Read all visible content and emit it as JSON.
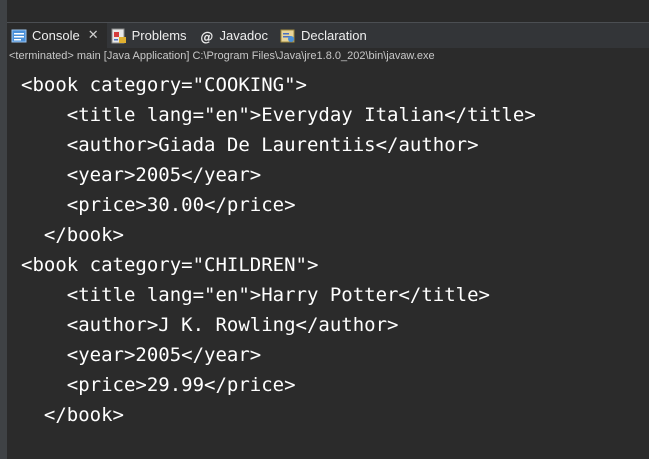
{
  "tabs": [
    {
      "label": "Console",
      "icon": "console-icon",
      "active": true,
      "closable": true
    },
    {
      "label": "Problems",
      "icon": "problems-icon",
      "active": false
    },
    {
      "label": "Javadoc",
      "icon": "javadoc-icon",
      "active": false
    },
    {
      "label": "Declaration",
      "icon": "declaration-icon",
      "active": false
    }
  ],
  "status_line": "<terminated> main [Java Application] C:\\Program Files\\Java\\jre1.8.0_202\\bin\\javaw.exe",
  "console_lines": [
    "<book category=\"COOKING\">",
    "    <title lang=\"en\">Everyday Italian</title>",
    "    <author>Giada De Laurentiis</author>",
    "    <year>2005</year>",
    "    <price>30.00</price>",
    "  </book>",
    "<book category=\"CHILDREN\">",
    "    <title lang=\"en\">Harry Potter</title>",
    "    <author>J K. Rowling</author>",
    "    <year>2005</year>",
    "    <price>29.99</price>",
    "  </book>"
  ],
  "colors": {
    "console_background": "#2b2b2b",
    "console_text": "#ffffff",
    "tab_bar": "#333538",
    "status_text": "#c8c8c8"
  }
}
